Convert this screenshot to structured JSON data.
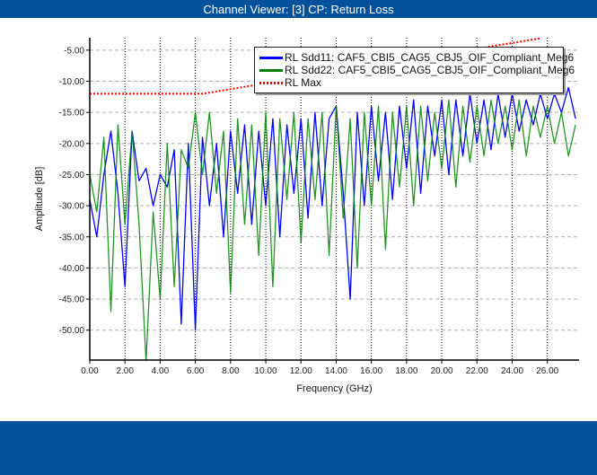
{
  "window": {
    "title": "Channel Viewer: [3] CP: Return Loss"
  },
  "chart_data": {
    "type": "line",
    "title": "",
    "xlabel": "Frequency (GHz)",
    "ylabel": "Amplitude [dB]",
    "xlim": [
      0,
      27.8
    ],
    "ylim": [
      -54.8,
      -3
    ],
    "x_ticks": [
      "0.00",
      "2.00",
      "4.00",
      "6.00",
      "8.00",
      "10.00",
      "12.00",
      "14.00",
      "16.00",
      "18.00",
      "20.00",
      "22.00",
      "24.00",
      "26.00"
    ],
    "y_ticks": [
      "-5.00",
      "-10.00",
      "-15.00",
      "-20.00",
      "-25.00",
      "-30.00",
      "-35.00",
      "-40.00",
      "-45.00",
      "-50.00"
    ],
    "grid": true,
    "legend_placement": "top-right",
    "x": [
      0,
      0.4,
      0.8,
      1.2,
      1.6,
      2.0,
      2.4,
      2.8,
      3.2,
      3.6,
      4.0,
      4.4,
      4.8,
      5.2,
      5.6,
      6.0,
      6.4,
      6.8,
      7.2,
      7.6,
      8.0,
      8.4,
      8.8,
      9.2,
      9.6,
      10.0,
      10.4,
      10.8,
      11.2,
      11.6,
      12.0,
      12.4,
      12.8,
      13.2,
      13.6,
      14.0,
      14.4,
      14.8,
      15.2,
      15.6,
      16.0,
      16.4,
      16.8,
      17.2,
      17.6,
      18.0,
      18.4,
      18.8,
      19.2,
      19.6,
      20.0,
      20.4,
      20.8,
      21.2,
      21.6,
      22.0,
      22.4,
      22.8,
      23.2,
      23.6,
      24.0,
      24.4,
      24.8,
      25.2,
      25.6,
      26.0,
      26.4,
      26.8,
      27.2,
      27.6
    ],
    "series": [
      {
        "name": "RL Sdd11: CAF5_CBI5_CAG5_CBJ5_OIF_Compliant_Meg6",
        "color": "#0000ff",
        "values": [
          -29,
          -35,
          -25,
          -18,
          -28,
          -43,
          -18,
          -26,
          -24,
          -30,
          -25,
          -27,
          -21,
          -49,
          -20,
          -50,
          -19,
          -30,
          -20,
          -35,
          -18,
          -28,
          -17,
          -33,
          -18,
          -30,
          -16,
          -35,
          -17,
          -28,
          -16,
          -32,
          -15,
          -30,
          -16,
          -14,
          -28,
          -45,
          -15,
          -30,
          -14,
          -26,
          -15,
          -29,
          -14,
          -24,
          -13,
          -28,
          -14,
          -22,
          -13,
          -25,
          -13,
          -22,
          -12,
          -20,
          -13,
          -21,
          -12,
          -19,
          -12,
          -18,
          -13,
          -17,
          -12,
          -16,
          -12,
          -15,
          -11,
          -16
        ]
      },
      {
        "name": "RL Sdd22: CAF5_CBI5_CAG5_CBJ5_OIF_Compliant_Meg6",
        "color": "#008000",
        "values": [
          -25,
          -31,
          -19,
          -47,
          -17,
          -33,
          -18,
          -33,
          -55,
          -31,
          -45,
          -20,
          -43,
          -21,
          -24,
          -15,
          -25,
          -15,
          -28,
          -18,
          -44,
          -16,
          -33,
          -17,
          -38,
          -15,
          -43,
          -16,
          -29,
          -15,
          -36,
          -16,
          -29,
          -15,
          -38,
          -14,
          -32,
          -16,
          -40,
          -15,
          -30,
          -14,
          -37,
          -15,
          -27,
          -14,
          -30,
          -14,
          -26,
          -15,
          -24,
          -13,
          -27,
          -14,
          -23,
          -14,
          -22,
          -13,
          -20,
          -14,
          -21,
          -13,
          -22,
          -14,
          -19,
          -14,
          -20,
          -15,
          -22,
          -17
        ]
      },
      {
        "name": "RL Max",
        "color": "#ff0000",
        "style": "dotted",
        "x": [
          0,
          6.4,
          25.6
        ],
        "values": [
          -12,
          -12,
          -3.1
        ]
      }
    ]
  }
}
